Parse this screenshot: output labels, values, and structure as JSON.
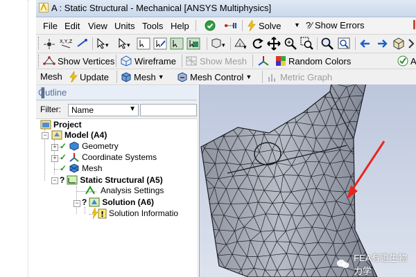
{
  "window": {
    "title": "A : Static Structural - Mechanical [ANSYS Multiphysics]"
  },
  "menubar": {
    "items": [
      "File",
      "Edit",
      "View",
      "Units",
      "Tools",
      "Help"
    ],
    "solve_label": "Solve",
    "show_errors_label": "?⁄ Show Errors"
  },
  "toolbar2": {
    "show_vertices_label": "Show Vertices",
    "wireframe_label": "Wireframe",
    "show_mesh_label": "Show Mesh",
    "random_colors_label": "Random Colors",
    "a_label": "A"
  },
  "toolbar3": {
    "mesh_label": "Mesh",
    "update_label": "Update",
    "mesh_menu_label": "Mesh",
    "mesh_control_label": "Mesh Control",
    "metric_graph_label": "Metric Graph"
  },
  "outline": {
    "title": "Outline",
    "pin": "▐",
    "filter_label": "Filter:",
    "filter_value": "Name",
    "tree": [
      {
        "label": "Project"
      },
      {
        "label": "Model (A4)"
      },
      {
        "label": "Geometry"
      },
      {
        "label": "Coordinate Systems"
      },
      {
        "label": "Mesh"
      },
      {
        "label": "Static Structural (A5)"
      },
      {
        "label": "Analysis Settings"
      },
      {
        "label": "Solution (A6)"
      },
      {
        "label": "Solution Informatio"
      }
    ],
    "question_mark": "?"
  },
  "watermark": {
    "text": "FEA有道生物力学"
  },
  "colors": {
    "arrow": "#e8251c",
    "mesh_fill": "#a4a9b4",
    "mesh_line": "#1b1d24",
    "check_green": "#1e9b1e"
  }
}
